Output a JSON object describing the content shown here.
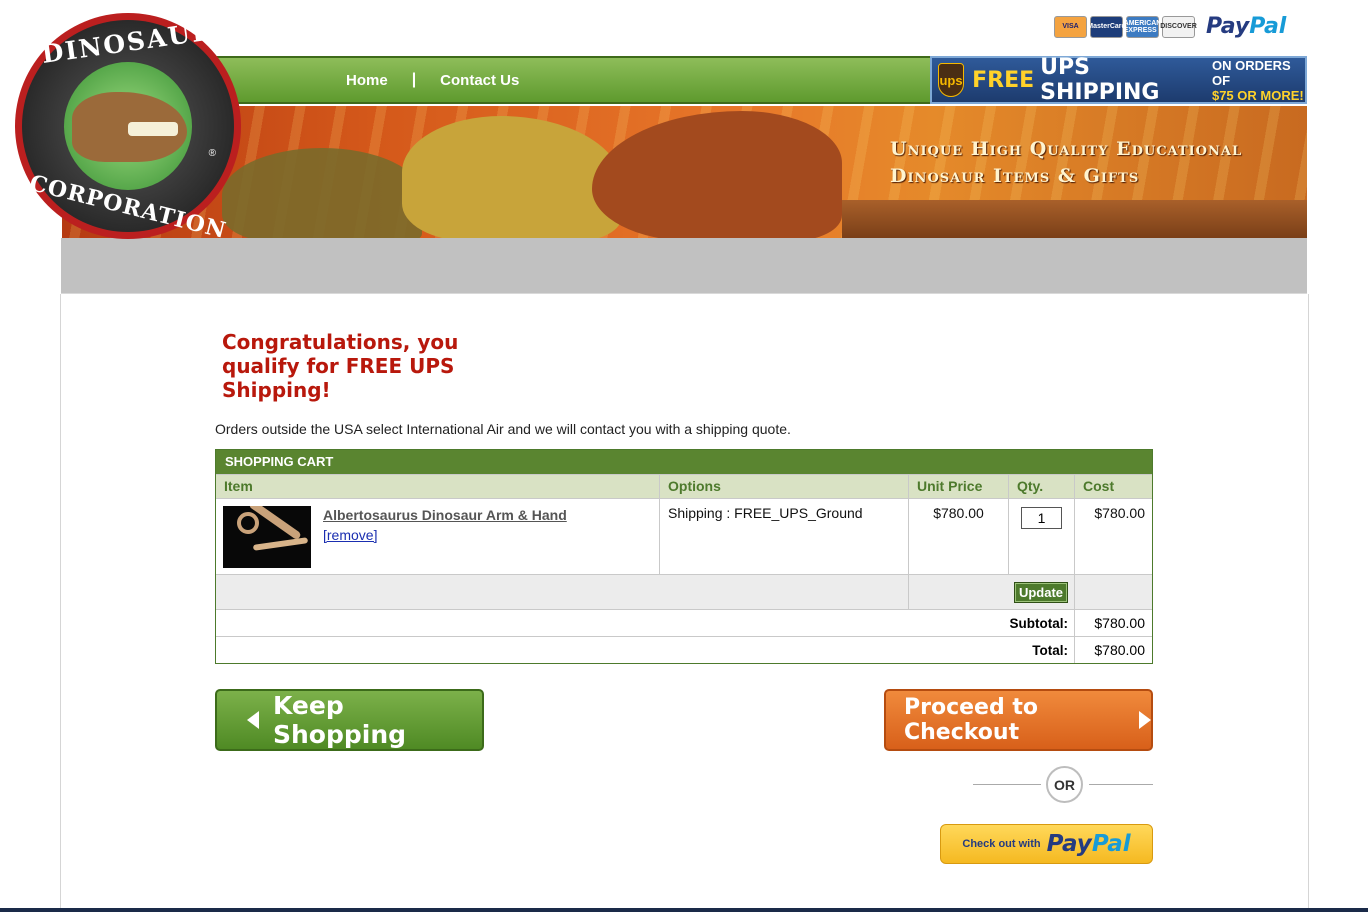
{
  "header": {
    "payment_cards": [
      "VISA",
      "MasterCard",
      "AMERICAN EXPRESS",
      "DISCOVER"
    ],
    "paypal_word_1": "Pay",
    "paypal_word_2": "Pal"
  },
  "logo": {
    "top_text": "DINOSAUR",
    "bottom_text": "CORPORATION",
    "reg": "®"
  },
  "nav": {
    "home": "Home",
    "separator": "|",
    "contact": "Contact Us"
  },
  "ups_banner": {
    "badge": "ups",
    "free": "FREE",
    "shipping": "UPS SHIPPING",
    "orders_line1": "ON ORDERS OF",
    "orders_line2": "$75 OR MORE!"
  },
  "banner": {
    "line1": "Unique High Quality Educational",
    "line2": "Dinosaur Items & Gifts"
  },
  "congrats": "Congratulations, you qualify for FREE UPS Shipping!",
  "note": "Orders outside the USA select International Air and we will contact you with a shipping quote.",
  "cart": {
    "title": "SHOPPING CART",
    "columns": [
      "Item",
      "Options",
      "Unit Price",
      "Qty.",
      "Cost"
    ],
    "items": [
      {
        "name": "Albertosaurus Dinosaur Arm & Hand",
        "remove": "[remove]",
        "options": "Shipping : FREE_UPS_Ground",
        "unit_price": "$780.00",
        "qty": "1",
        "cost": "$780.00"
      }
    ],
    "update_label": "Update",
    "subtotal_label": "Subtotal:",
    "subtotal": "$780.00",
    "total_label": "Total:",
    "total": "$780.00"
  },
  "actions": {
    "keep_shopping": "Keep Shopping",
    "checkout": "Proceed to Checkout",
    "or": "OR",
    "paypal_prefix": "Check out with",
    "paypal_word_1": "Pay",
    "paypal_word_2": "Pal"
  },
  "colors": {
    "accent_green": "#5a8530",
    "accent_orange": "#e07226",
    "alert_red": "#b8180c"
  }
}
